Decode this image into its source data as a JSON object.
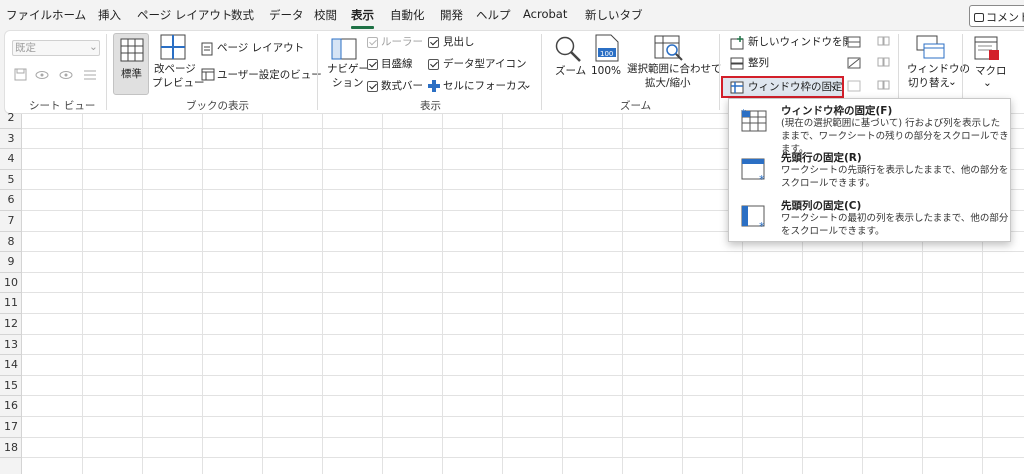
{
  "tabs": [
    "ファイル",
    "ホーム",
    "挿入",
    "ページ レイアウト",
    "数式",
    "データ",
    "校閲",
    "表示",
    "自動化",
    "開発",
    "ヘルプ",
    "Acrobat",
    "新しいタブ"
  ],
  "active_tab": "表示",
  "comment_label": "コメント",
  "groups": {
    "sheet_view": {
      "label": "シート ビュー",
      "dropdown_value": "既定"
    },
    "workbook_views": {
      "label": "ブックの表示",
      "normal": "標準",
      "page_break_1": "改ページ",
      "page_break_2": "プレビュー",
      "page_layout": "ページ レイアウト",
      "custom_views": "ユーザー設定のビュー"
    },
    "show": {
      "label": "表示",
      "navigation_1": "ナビゲー",
      "navigation_2": "ション",
      "ruler": "ルーラー",
      "gridlines": "目盛線",
      "formula_bar": "数式バー",
      "headings": "見出し",
      "data_icons": "データ型アイコン",
      "focus_cell": "セルにフォーカス"
    },
    "zoom": {
      "label": "ズーム",
      "zoom": "ズーム",
      "zoom100": "100%",
      "zoom_selection_1": "選択範囲に合わせて",
      "zoom_selection_2": "拡大/縮小"
    },
    "window": {
      "new_window": "新しいウィンドウを開く",
      "arrange": "整列",
      "freeze_panes": "ウィンドウ枠の固定",
      "switch_1": "ウィンドウの",
      "switch_2": "切り替え"
    },
    "macros": {
      "label": "マクロ"
    }
  },
  "freeze_menu": [
    {
      "title": "ウィンドウ枠の固定(F)",
      "desc": "(現在の選択範囲に基づいて) 行および列を表示したままで、ワークシートの残りの部分をスクロールできます。"
    },
    {
      "title": "先頭行の固定(R)",
      "desc": "ワークシートの先頭行を表示したままで、他の部分をスクロールできます。"
    },
    {
      "title": "先頭列の固定(C)",
      "desc": "ワークシートの最初の列を表示したままで、他の部分をスクロールできます。"
    }
  ],
  "rows": [
    "2",
    "3",
    "4",
    "5",
    "6",
    "7",
    "8",
    "9",
    "10",
    "11",
    "12",
    "13",
    "14",
    "15",
    "16",
    "17",
    "18"
  ]
}
